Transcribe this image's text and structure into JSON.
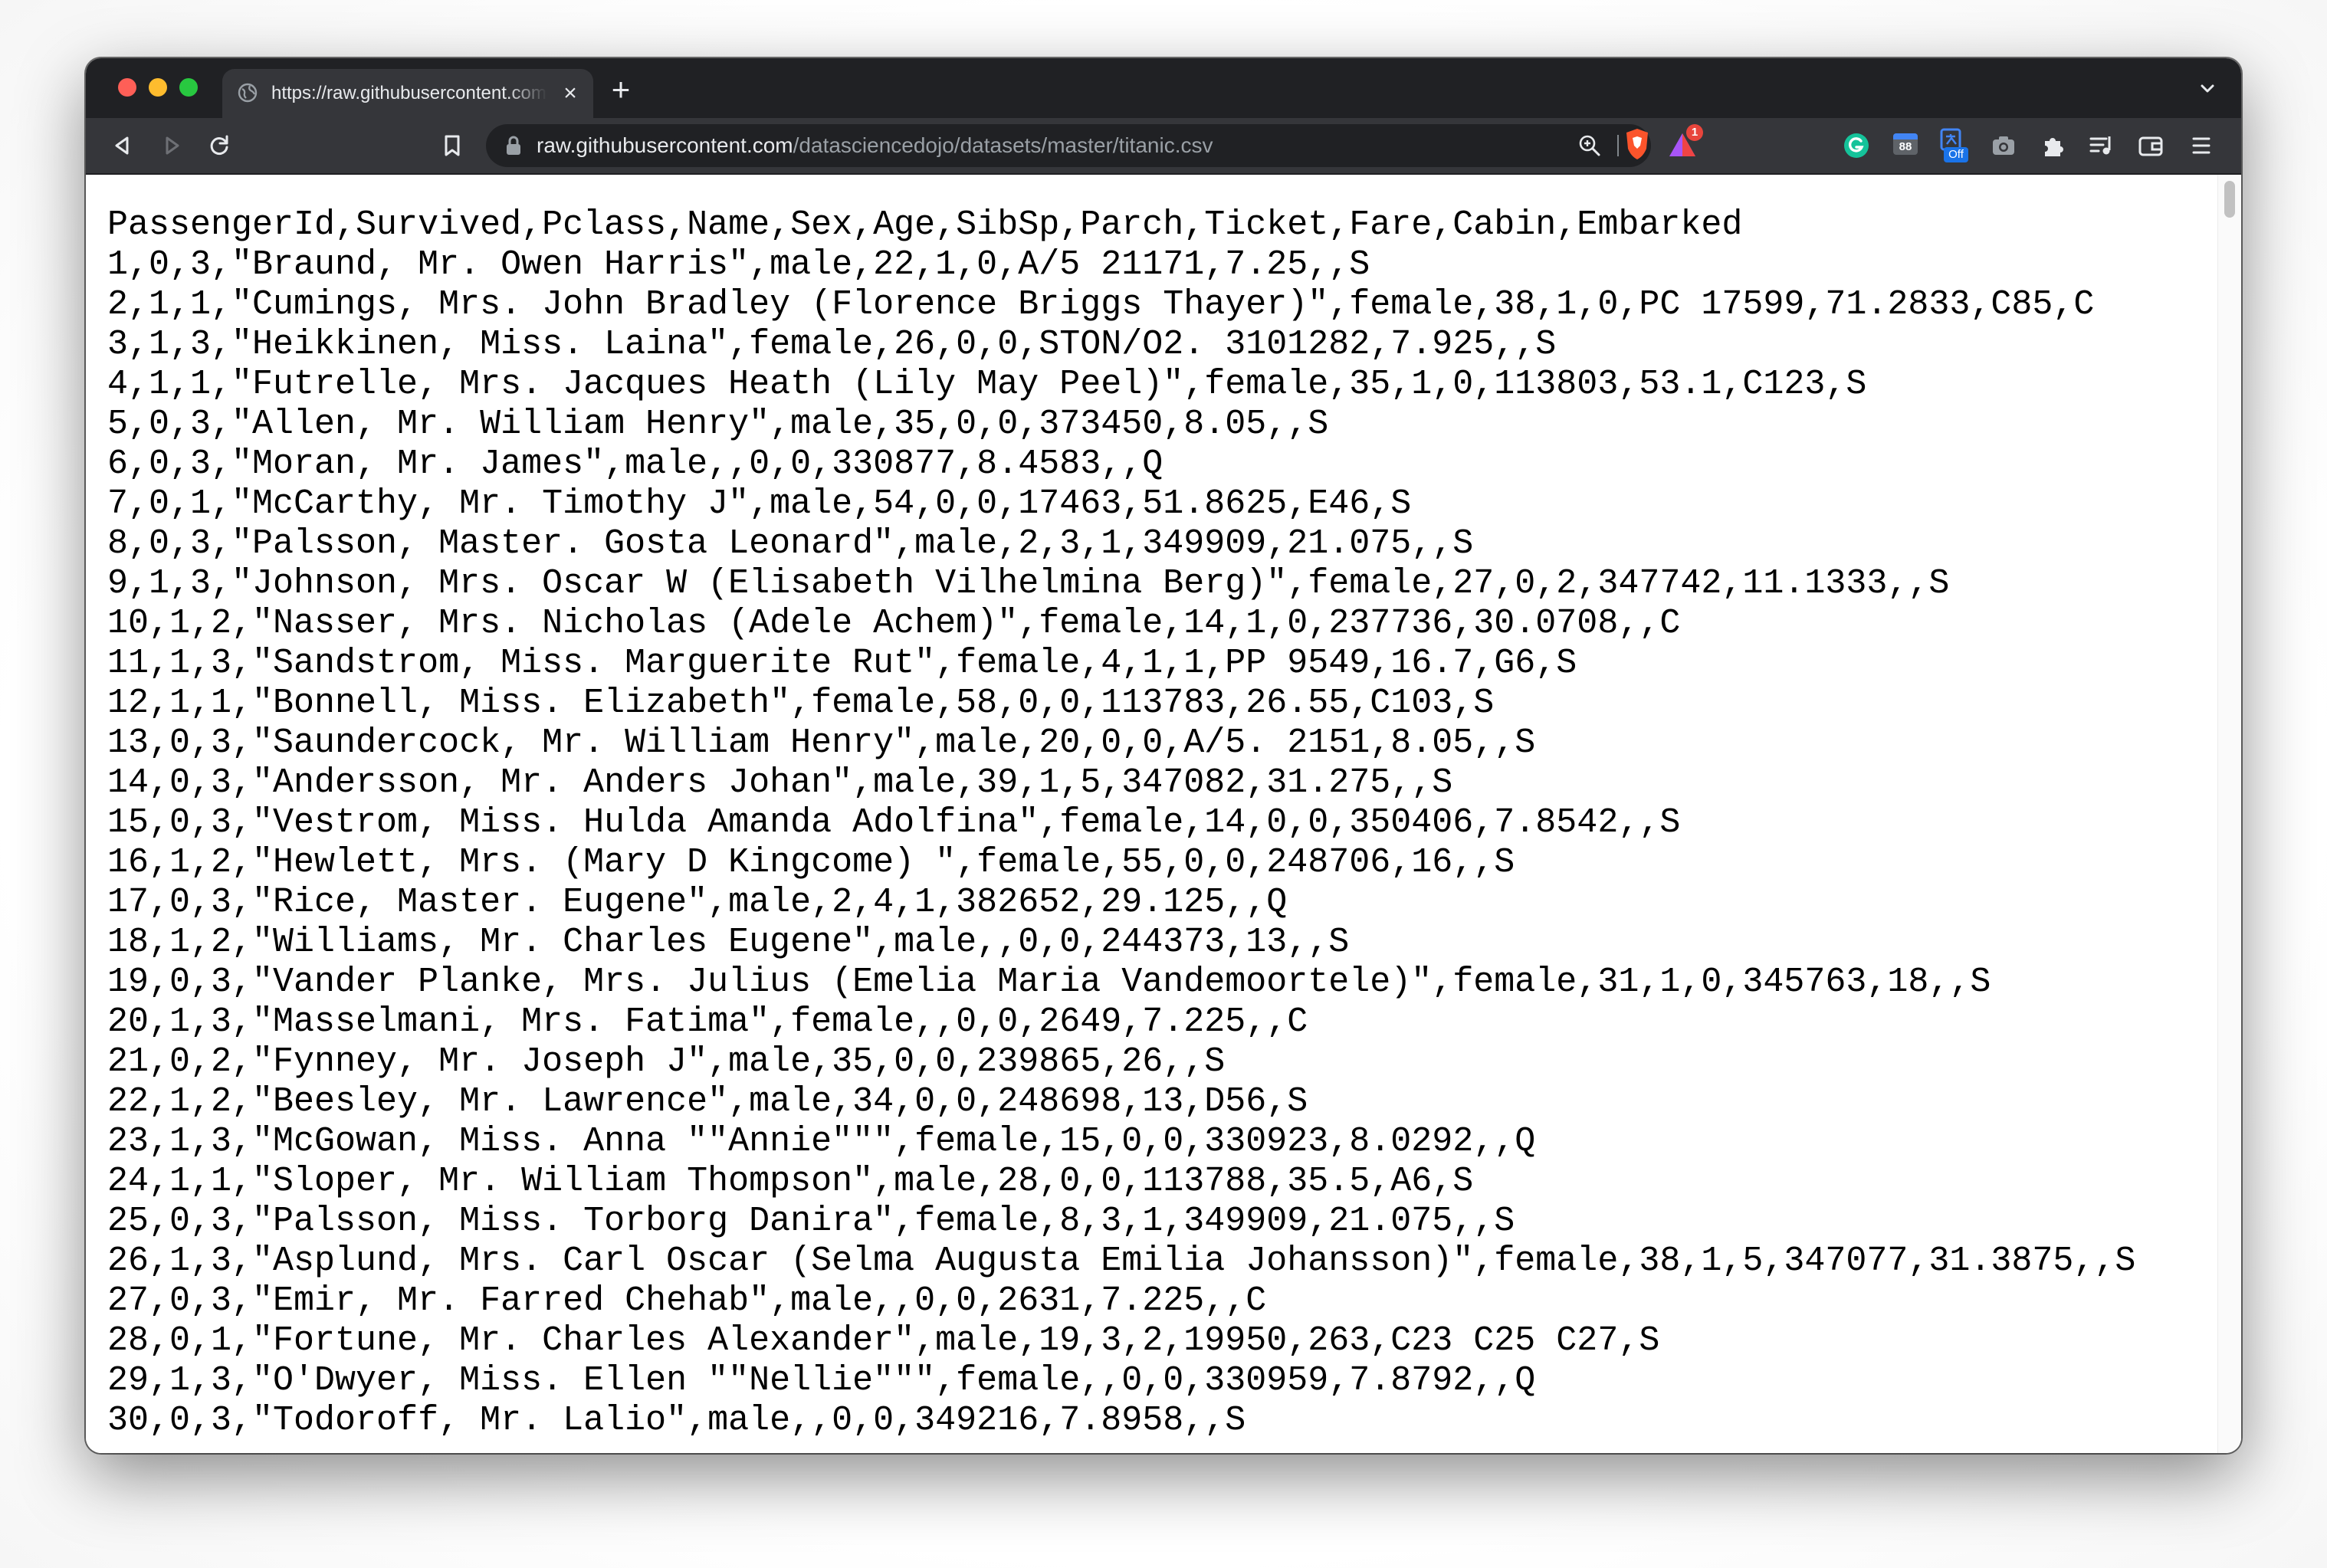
{
  "browser": {
    "tab": {
      "title": "https://raw.githubusercontent.com/datasciencedojo/datasets/master/titanic.csv",
      "close_symbol": "×"
    },
    "new_tab_symbol": "+",
    "address_bar": {
      "host": "raw.githubusercontent.com",
      "path": "/datasciencedojo/datasets/master/titanic.csv"
    },
    "notification_badge": "1",
    "extension_badge": "88",
    "extension_off_label": "Off"
  },
  "icons": [
    "window-close-icon",
    "window-minimize-icon",
    "window-zoom-icon",
    "globe-icon",
    "back-icon",
    "forward-icon",
    "reload-icon",
    "bookmark-icon",
    "lock-icon",
    "zoom-icon",
    "brave-shield-icon",
    "brave-rewards-icon",
    "grammarly-icon",
    "calendar-extension-icon",
    "translate-extension-icon",
    "screenshot-extension-icon",
    "extensions-puzzle-icon",
    "reading-list-icon",
    "wallet-icon",
    "menu-icon",
    "tab-search-icon"
  ],
  "csv_lines": [
    "PassengerId,Survived,Pclass,Name,Sex,Age,SibSp,Parch,Ticket,Fare,Cabin,Embarked",
    "1,0,3,\"Braund, Mr. Owen Harris\",male,22,1,0,A/5 21171,7.25,,S",
    "2,1,1,\"Cumings, Mrs. John Bradley (Florence Briggs Thayer)\",female,38,1,0,PC 17599,71.2833,C85,C",
    "3,1,3,\"Heikkinen, Miss. Laina\",female,26,0,0,STON/O2. 3101282,7.925,,S",
    "4,1,1,\"Futrelle, Mrs. Jacques Heath (Lily May Peel)\",female,35,1,0,113803,53.1,C123,S",
    "5,0,3,\"Allen, Mr. William Henry\",male,35,0,0,373450,8.05,,S",
    "6,0,3,\"Moran, Mr. James\",male,,0,0,330877,8.4583,,Q",
    "7,0,1,\"McCarthy, Mr. Timothy J\",male,54,0,0,17463,51.8625,E46,S",
    "8,0,3,\"Palsson, Master. Gosta Leonard\",male,2,3,1,349909,21.075,,S",
    "9,1,3,\"Johnson, Mrs. Oscar W (Elisabeth Vilhelmina Berg)\",female,27,0,2,347742,11.1333,,S",
    "10,1,2,\"Nasser, Mrs. Nicholas (Adele Achem)\",female,14,1,0,237736,30.0708,,C",
    "11,1,3,\"Sandstrom, Miss. Marguerite Rut\",female,4,1,1,PP 9549,16.7,G6,S",
    "12,1,1,\"Bonnell, Miss. Elizabeth\",female,58,0,0,113783,26.55,C103,S",
    "13,0,3,\"Saundercock, Mr. William Henry\",male,20,0,0,A/5. 2151,8.05,,S",
    "14,0,3,\"Andersson, Mr. Anders Johan\",male,39,1,5,347082,31.275,,S",
    "15,0,3,\"Vestrom, Miss. Hulda Amanda Adolfina\",female,14,0,0,350406,7.8542,,S",
    "16,1,2,\"Hewlett, Mrs. (Mary D Kingcome) \",female,55,0,0,248706,16,,S",
    "17,0,3,\"Rice, Master. Eugene\",male,2,4,1,382652,29.125,,Q",
    "18,1,2,\"Williams, Mr. Charles Eugene\",male,,0,0,244373,13,,S",
    "19,0,3,\"Vander Planke, Mrs. Julius (Emelia Maria Vandemoortele)\",female,31,1,0,345763,18,,S",
    "20,1,3,\"Masselmani, Mrs. Fatima\",female,,0,0,2649,7.225,,C",
    "21,0,2,\"Fynney, Mr. Joseph J\",male,35,0,0,239865,26,,S",
    "22,1,2,\"Beesley, Mr. Lawrence\",male,34,0,0,248698,13,D56,S",
    "23,1,3,\"McGowan, Miss. Anna \"\"Annie\"\"\",female,15,0,0,330923,8.0292,,Q",
    "24,1,1,\"Sloper, Mr. William Thompson\",male,28,0,0,113788,35.5,A6,S",
    "25,0,3,\"Palsson, Miss. Torborg Danira\",female,8,3,1,349909,21.075,,S",
    "26,1,3,\"Asplund, Mrs. Carl Oscar (Selma Augusta Emilia Johansson)\",female,38,1,5,347077,31.3875,,S",
    "27,0,3,\"Emir, Mr. Farred Chehab\",male,,0,0,2631,7.225,,C",
    "28,0,1,\"Fortune, Mr. Charles Alexander\",male,19,3,2,19950,263,C23 C25 C27,S",
    "29,1,3,\"O'Dwyer, Miss. Ellen \"\"Nellie\"\"\",female,,0,0,330959,7.8792,,Q",
    "30,0,3,\"Todoroff, Mr. Lalio\",male,,0,0,349216,7.8958,,S"
  ]
}
